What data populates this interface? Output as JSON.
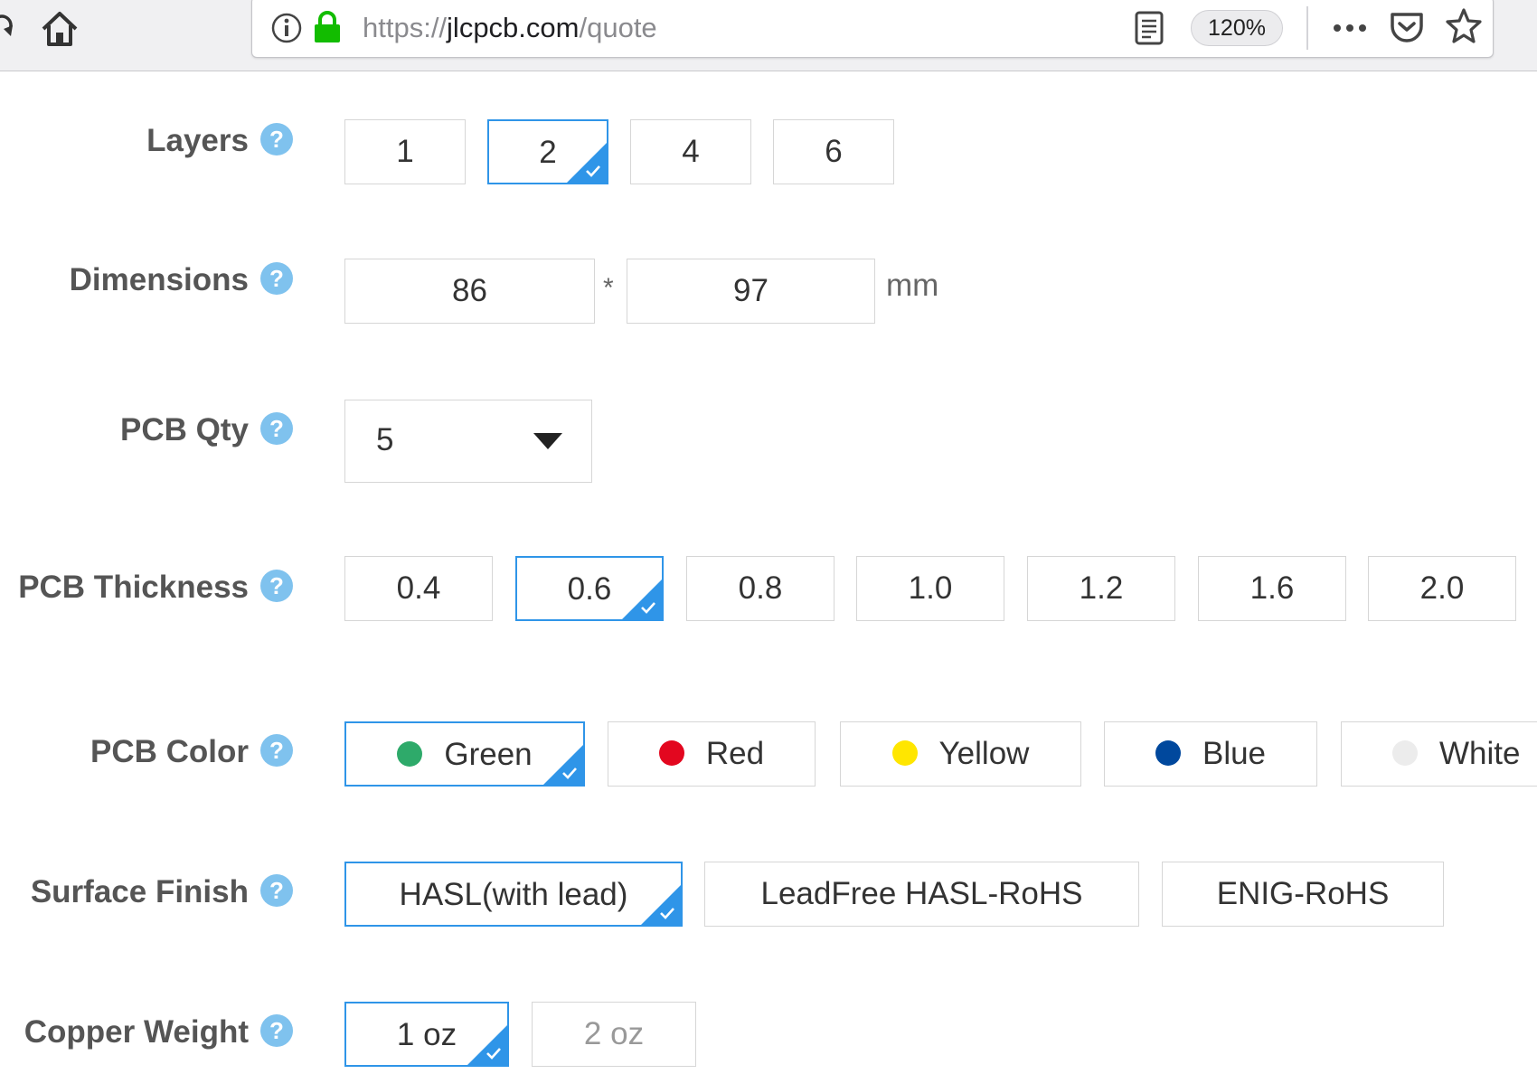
{
  "browser": {
    "url_scheme": "https://",
    "url_domain": "jlcpcb.com",
    "url_path": "/quote",
    "zoom": "120%"
  },
  "form": {
    "help_glyph": "?",
    "layers": {
      "label": "Layers",
      "options": [
        "1",
        "2",
        "4",
        "6"
      ],
      "selected": "2"
    },
    "dimensions": {
      "label": "Dimensions",
      "width": "86",
      "height": "97",
      "separator": "*",
      "unit": "mm"
    },
    "qty": {
      "label": "PCB Qty",
      "value": "5"
    },
    "thickness": {
      "label": "PCB Thickness",
      "options": [
        "0.4",
        "0.6",
        "0.8",
        "1.0",
        "1.2",
        "1.6",
        "2.0"
      ],
      "selected": "0.6"
    },
    "color": {
      "label": "PCB Color",
      "options": [
        {
          "name": "Green",
          "swatch": "#2eaa6a"
        },
        {
          "name": "Red",
          "swatch": "#e3071f"
        },
        {
          "name": "Yellow",
          "swatch": "#ffe600"
        },
        {
          "name": "Blue",
          "swatch": "#00489d"
        },
        {
          "name": "White",
          "swatch": "#ececec"
        }
      ],
      "selected": "Green"
    },
    "surface": {
      "label": "Surface Finish",
      "options": [
        "HASL(with lead)",
        "LeadFree HASL-RoHS",
        "ENIG-RoHS"
      ],
      "selected": "HASL(with lead)"
    },
    "copper": {
      "label": "Copper Weight",
      "options": [
        "1 oz",
        "2 oz"
      ],
      "selected": "1 oz"
    }
  },
  "colors": {
    "accent": "#2f95e8",
    "help": "#7fc2ee",
    "border": "#d6d6d6"
  }
}
